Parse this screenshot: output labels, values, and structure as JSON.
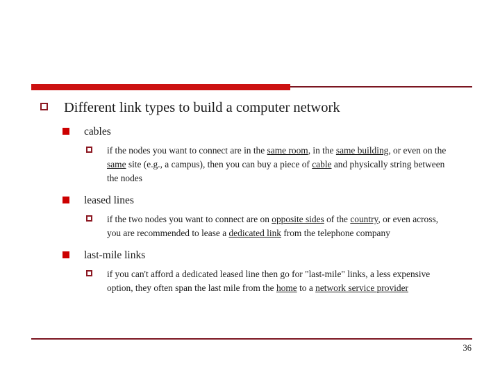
{
  "slide": {
    "accent_color_bar": "#CC1111",
    "accent_color_rule": "#7B1520",
    "bullet_color_outline": "#8C1822",
    "bullet_color_filled": "#CC0000",
    "page_number": "36",
    "title": "Different link types to build a computer network",
    "items": [
      {
        "label": "cables",
        "detail_runs": [
          {
            "text": "if the nodes you want to connect are in the ",
            "underline": false
          },
          {
            "text": "same room",
            "underline": true
          },
          {
            "text": ", in the ",
            "underline": false
          },
          {
            "text": "same building",
            "underline": true
          },
          {
            "text": ", or even on the ",
            "underline": false
          },
          {
            "text": "same",
            "underline": true
          },
          {
            "text": " site (e.g., a campus), then you can buy a piece of ",
            "underline": false
          },
          {
            "text": "cable",
            "underline": true
          },
          {
            "text": " and physically string between the nodes",
            "underline": false
          }
        ]
      },
      {
        "label": "leased lines",
        "detail_runs": [
          {
            "text": "if the two nodes you want to connect are on ",
            "underline": false
          },
          {
            "text": "opposite sides",
            "underline": true
          },
          {
            "text": " of the ",
            "underline": false
          },
          {
            "text": "country",
            "underline": true
          },
          {
            "text": ", or even across, you are recommended to lease a ",
            "underline": false
          },
          {
            "text": "dedicated link",
            "underline": true
          },
          {
            "text": " from the telephone company",
            "underline": false
          }
        ]
      },
      {
        "label": "last-mile links",
        "detail_runs": [
          {
            "text": "if you can't afford a dedicated leased line then go for \"last-mile\" links, a less expensive option, they often span the last mile from the ",
            "underline": false
          },
          {
            "text": "home",
            "underline": true
          },
          {
            "text": " to a ",
            "underline": false
          },
          {
            "text": "network service provider",
            "underline": true
          }
        ]
      }
    ]
  }
}
